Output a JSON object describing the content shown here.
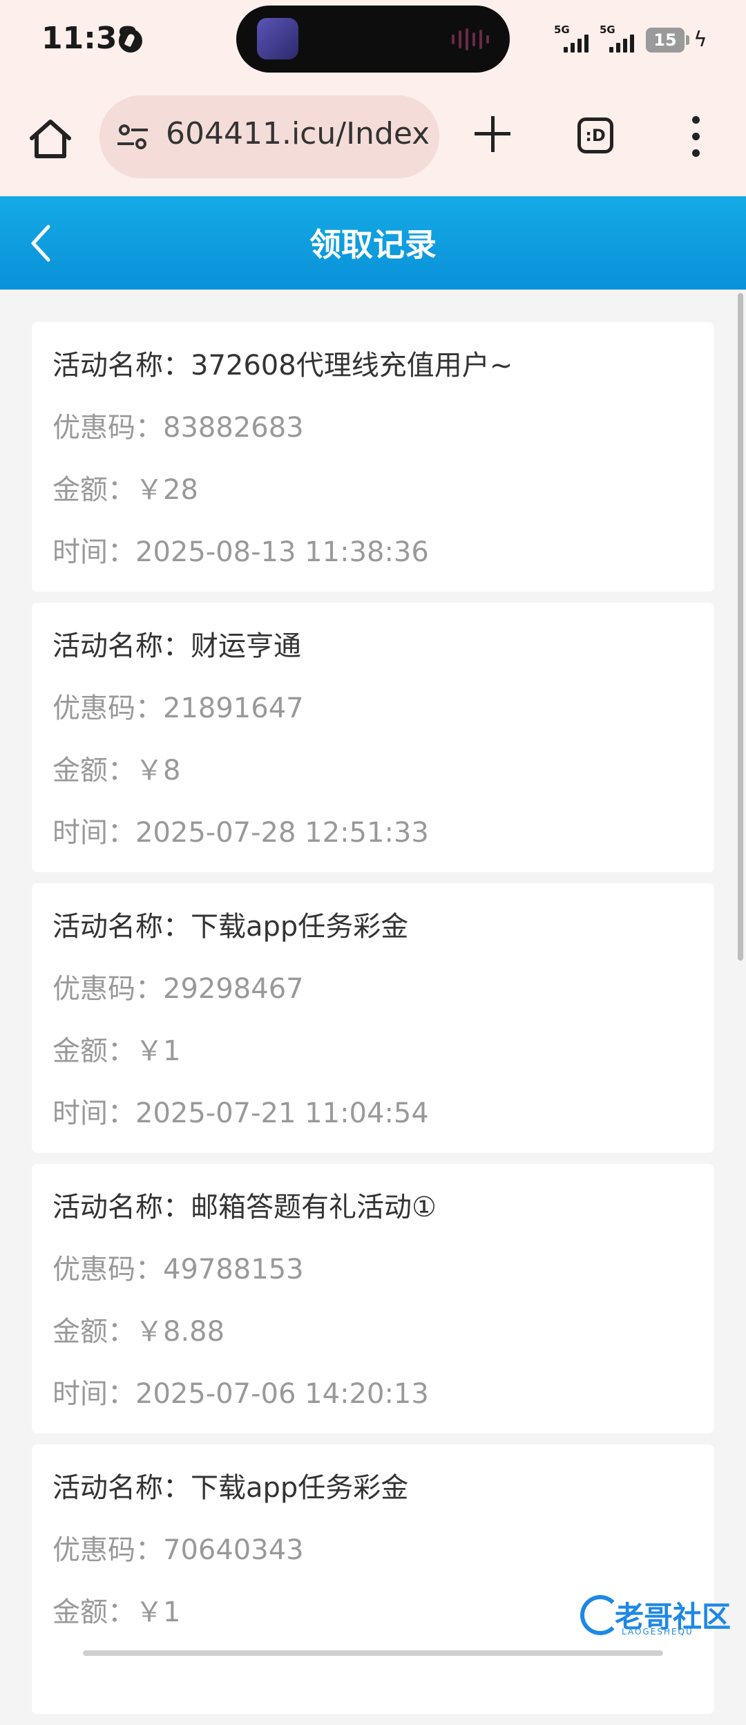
{
  "status_bar": {
    "time": "11:38",
    "signal1_label": "5G",
    "signal2_label": "5G",
    "battery": "15"
  },
  "browser": {
    "url": "604411.icu/Index.",
    "tab_button_label": ":D"
  },
  "header": {
    "title": "领取记录"
  },
  "records": [
    {
      "activity": "活动名称：372608代理线充值用户~",
      "code": "优惠码：83882683",
      "amount": "金额：￥28",
      "time": "时间：2025-08-13 11:38:36"
    },
    {
      "activity": "活动名称：财运亨通",
      "code": "优惠码：21891647",
      "amount": "金额：￥8",
      "time": "时间：2025-07-28 12:51:33"
    },
    {
      "activity": "活动名称：下载app任务彩金",
      "code": "优惠码：29298467",
      "amount": "金额：￥1",
      "time": "时间：2025-07-21 11:04:54"
    },
    {
      "activity": "活动名称：邮箱答题有礼活动①",
      "code": "优惠码：49788153",
      "amount": "金额：￥8.88",
      "time": "时间：2025-07-06 14:20:13"
    },
    {
      "activity": "活动名称：下载app任务彩金",
      "code": "优惠码：70640343",
      "amount": "金额：￥1",
      "time": ""
    }
  ],
  "watermark": {
    "text": "老哥社区",
    "sub": "LAOGESHEQU"
  },
  "colors": {
    "header_blue": "#0a9ddf",
    "chrome_bg": "#fcefec",
    "page_bg": "#f4f4f4"
  }
}
